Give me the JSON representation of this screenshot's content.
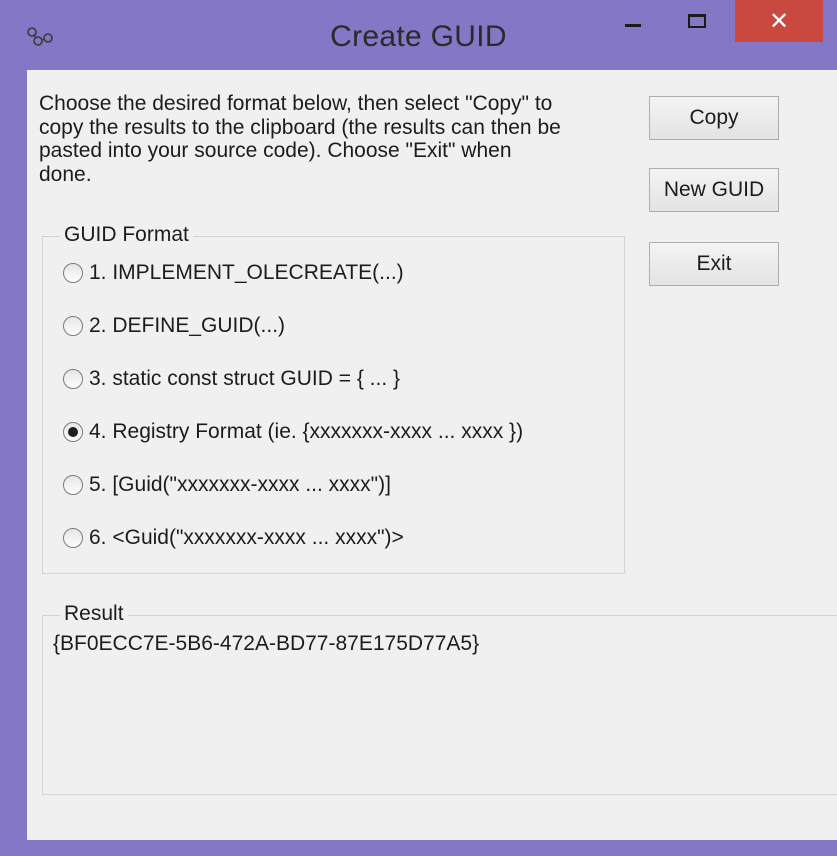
{
  "window": {
    "title": "Create GUID",
    "close_glyph": "✕",
    "icon": "create-guid-app-icon"
  },
  "instructions": "Choose the desired format below, then select \"Copy\" to\ncopy the results to the clipboard (the results can then be\npasted into your source code).  Choose \"Exit\" when\ndone.",
  "buttons": {
    "copy": "Copy",
    "new_guid": "New GUID",
    "exit": "Exit"
  },
  "format_group": {
    "label": "GUID Format",
    "selected_index": 3,
    "options": [
      "1. IMPLEMENT_OLECREATE(...)",
      "2. DEFINE_GUID(...)",
      "3. static const struct GUID = { ... }",
      "4. Registry Format (ie. {xxxxxxx-xxxx ... xxxx })",
      "5. [Guid(\"xxxxxxx-xxxx ... xxxx\")]",
      "6. <Guid(\"xxxxxxx-xxxx ... xxxx\")>"
    ]
  },
  "result_group": {
    "label": "Result",
    "value": "{BF0ECC7E-5B6-472A-BD77-87E175D77A5}"
  }
}
